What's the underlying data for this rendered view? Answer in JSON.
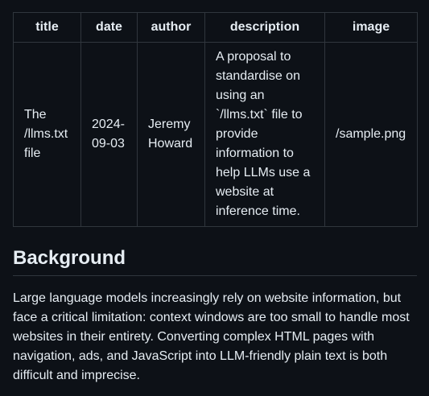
{
  "table": {
    "headers": [
      "title",
      "date",
      "author",
      "description",
      "image"
    ],
    "row": {
      "title": "The /llms.txt file",
      "date": "2024-09-03",
      "author": "Jeremy Howard",
      "description": "A proposal to standardise on using an `/llms.txt` file to provide information to help LLMs use a website at inference time.",
      "image": "/sample.png"
    }
  },
  "section": {
    "heading": "Background",
    "paragraph": "Large language models increasingly rely on website information, but face a critical limitation: context windows are too small to handle most websites in their entirety. Converting complex HTML pages with navigation, ads, and JavaScript into LLM-friendly plain text is both difficult and imprecise."
  }
}
